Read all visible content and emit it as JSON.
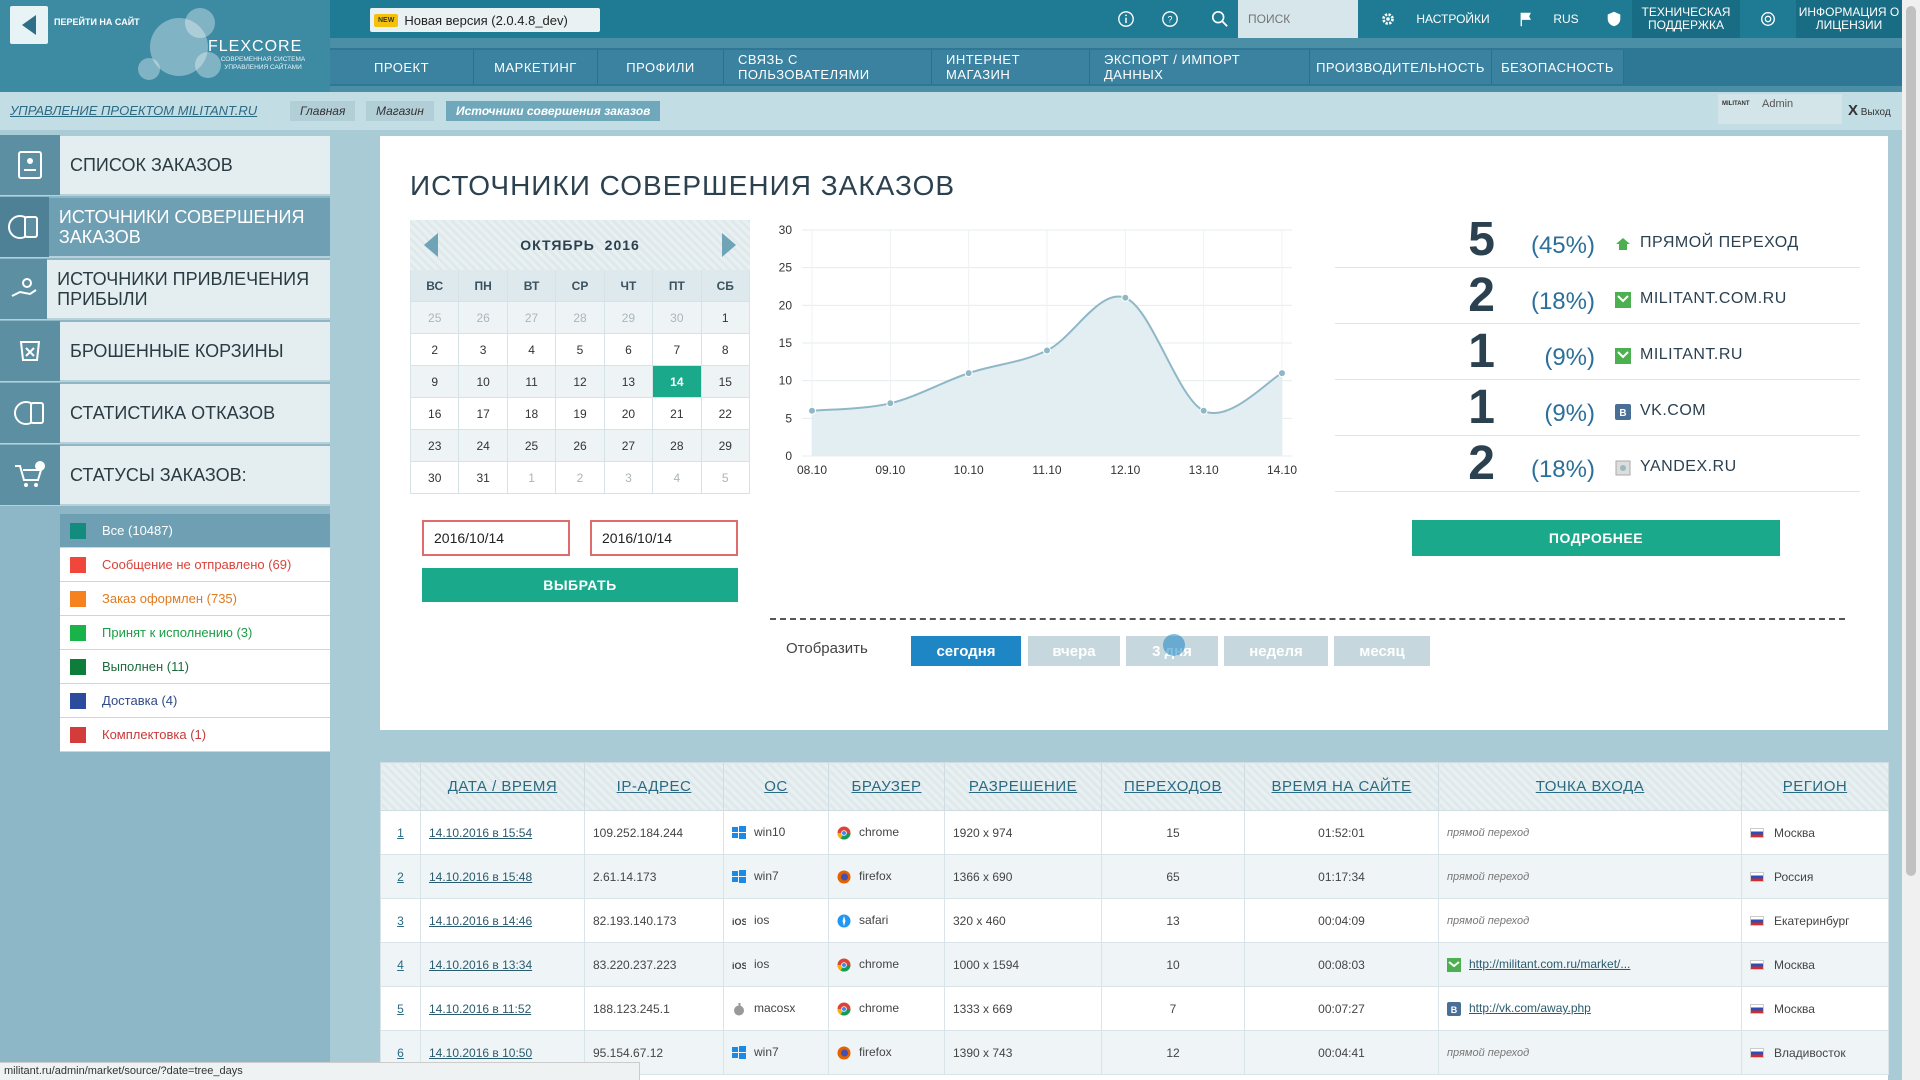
{
  "header": {
    "goto_site": "ПЕРЕЙТИ НА САЙТ",
    "logo": "FLEXCORE",
    "logo_sub": "СОВРЕМЕННАЯ СИСТЕМА УПРАВЛЕНИЯ САЙТАМИ",
    "new_badge": "NEW",
    "new_version": "Новая версия (2.0.4.8_dev)",
    "search_placeholder": "ПОИСК",
    "settings": "НАСТРОЙКИ",
    "lang": "RUS",
    "support": "ТЕХНИЧЕСКАЯ ПОДДЕРЖКА",
    "license": "ИНФОРМАЦИЯ О ЛИЦЕНЗИИ",
    "nav": [
      "ПРОЕКТ",
      "МАРКЕТИНГ",
      "ПРОФИЛИ",
      "СВЯЗЬ С ПОЛЬЗОВАТЕЛЯМИ",
      "ИНТЕРНЕТ МАГАЗИН",
      "ЭКСПОРТ / ИМПОРТ ДАННЫХ",
      "ПРОИЗВОДИТЕЛЬНОСТЬ",
      "БЕЗОПАСНОСТЬ"
    ]
  },
  "breadcrumbs": {
    "project": "УПРАВЛЕНИЕ ПРОЕКТОМ MILITANT.RU",
    "items": [
      "Главная",
      "Магазин",
      "Источники совершения заказов"
    ]
  },
  "user": {
    "name": "Admin",
    "logo": "MILITANT",
    "exit": "Выход",
    "exit_x": "X"
  },
  "sidebar": {
    "items": [
      "СПИСОК ЗАКАЗОВ",
      "ИСТОЧНИКИ СОВЕРШЕНИЯ ЗАКАЗОВ",
      "ИСТОЧНИКИ ПРИВЛЕЧЕНИЯ ПРИБЫЛИ",
      "БРОШЕННЫЕ КОРЗИНЫ",
      "СТАТИСТИКА ОТКАЗОВ",
      "СТАТУСЫ ЗАКАЗОВ:"
    ],
    "statuses": [
      {
        "label": "Все (10487)",
        "color": "#128c7e",
        "text": "#ffffff"
      },
      {
        "label": "Сообщение не отправлено (69)",
        "color": "#f0463c",
        "text": "#d9433b"
      },
      {
        "label": "Заказ оформлен (735)",
        "color": "#f5821f",
        "text": "#e07a20"
      },
      {
        "label": "Принят к исполнению (3)",
        "color": "#1ab34a",
        "text": "#1c9c47"
      },
      {
        "label": "Выполнен (11)",
        "color": "#0f7d3a",
        "text": "#1d6b3c"
      },
      {
        "label": "Доставка (4)",
        "color": "#2c4a9e",
        "text": "#2f4a8a"
      },
      {
        "label": "Комплектовка (1)",
        "color": "#d43c3c",
        "text": "#c73a3a"
      }
    ]
  },
  "main": {
    "title": "ИСТОЧНИКИ СОВЕРШЕНИЯ ЗАКАЗОВ",
    "calendar": {
      "month": "ОКТЯБРЬ",
      "year": "2016",
      "dow": [
        "ВС",
        "ПН",
        "ВТ",
        "СР",
        "ЧТ",
        "ПТ",
        "СБ"
      ],
      "weeks": [
        [
          "25",
          "26",
          "27",
          "28",
          "29",
          "30",
          "1"
        ],
        [
          "2",
          "3",
          "4",
          "5",
          "6",
          "7",
          "8"
        ],
        [
          "9",
          "10",
          "11",
          "12",
          "13",
          "14",
          "15"
        ],
        [
          "16",
          "17",
          "18",
          "19",
          "20",
          "21",
          "22"
        ],
        [
          "23",
          "24",
          "25",
          "26",
          "27",
          "28",
          "29"
        ],
        [
          "30",
          "31",
          "1",
          "2",
          "3",
          "4",
          "5"
        ]
      ],
      "selected": "14"
    },
    "date_from": "2016/10/14",
    "date_to": "2016/10/14",
    "select_btn": "ВЫБРАТЬ",
    "more_btn": "ПОДРОБНЕЕ",
    "show_label": "Отобразить",
    "periods": [
      "сегодня",
      "вчера",
      "3 дня",
      "неделя",
      "месяц"
    ],
    "active_period": "сегодня"
  },
  "chart_data": {
    "type": "area",
    "x": [
      "08.10",
      "09.10",
      "10.10",
      "11.10",
      "12.10",
      "13.10",
      "14.10"
    ],
    "values": [
      6,
      7,
      11,
      14,
      21,
      6,
      11
    ],
    "ylim": [
      0,
      30
    ],
    "yticks": [
      0,
      5,
      10,
      15,
      20,
      25,
      30
    ],
    "grid": true,
    "color": "#8fb8c6"
  },
  "sources": [
    {
      "count": "5",
      "pct": "(45%)",
      "label": "ПРЯМОЙ ПЕРЕХОД",
      "icon": "home-icon",
      "color": "#4caf50"
    },
    {
      "count": "2",
      "pct": "(18%)",
      "label": "MILITANT.COM.RU",
      "icon": "site-icon",
      "color": "#4caf50"
    },
    {
      "count": "1",
      "pct": "(9%)",
      "label": "MILITANT.RU",
      "icon": "site-icon",
      "color": "#4caf50"
    },
    {
      "count": "1",
      "pct": "(9%)",
      "label": "VK.COM",
      "icon": "vk-icon",
      "color": "#4a6f96"
    },
    {
      "count": "2",
      "pct": "(18%)",
      "label": "YANDEX.RU",
      "icon": "yandex-icon",
      "color": "#aaaaaa"
    }
  ],
  "table": {
    "headers": [
      "ДАТА / ВРЕМЯ",
      "IP-АДРЕС",
      "ОС",
      "БРАУЗЕР",
      "РАЗРЕШЕНИЕ",
      "ПЕРЕХОДОВ",
      "ВРЕМЯ НА САЙТЕ",
      "ТОЧКА ВХОДА",
      "РЕГИОН"
    ],
    "rows": [
      {
        "n": "1",
        "dt": "14.10.2016 в 15:54",
        "ip": "109.252.184.244",
        "os": "win10",
        "os_icon": "windows-icon",
        "br": "chrome",
        "br_icon": "chrome-icon",
        "res": "1920 x 974",
        "hits": "15",
        "time": "01:52:01",
        "entry": "прямой переход",
        "entry_link": false,
        "region": "Москва"
      },
      {
        "n": "2",
        "dt": "14.10.2016 в 15:48",
        "ip": "2.61.14.173",
        "os": "win7",
        "os_icon": "windows-icon",
        "br": "firefox",
        "br_icon": "firefox-icon",
        "res": "1366 x 690",
        "hits": "65",
        "time": "01:17:34",
        "entry": "прямой переход",
        "entry_link": false,
        "region": "Россия"
      },
      {
        "n": "3",
        "dt": "14.10.2016 в 14:46",
        "ip": "82.193.140.173",
        "os": "ios",
        "os_icon": "ios-icon",
        "br": "safari",
        "br_icon": "safari-icon",
        "res": "320 x 460",
        "hits": "13",
        "time": "00:04:09",
        "entry": "прямой переход",
        "entry_link": false,
        "region": "Екатеринбург"
      },
      {
        "n": "4",
        "dt": "14.10.2016 в 13:34",
        "ip": "83.220.237.223",
        "os": "ios",
        "os_icon": "ios-icon",
        "br": "chrome",
        "br_icon": "chrome-icon",
        "res": "1000 x 1594",
        "hits": "10",
        "time": "00:08:03",
        "entry": "http://militant.com.ru/market/...",
        "entry_link": true,
        "entry_icon": "site-icon",
        "region": "Москва"
      },
      {
        "n": "5",
        "dt": "14.10.2016 в 11:52",
        "ip": "188.123.245.1",
        "os": "macosx",
        "os_icon": "apple-icon",
        "br": "chrome",
        "br_icon": "chrome-icon",
        "res": "1333 x 669",
        "hits": "7",
        "time": "00:07:27",
        "entry": "http://vk.com/away.php",
        "entry_link": true,
        "entry_icon": "vk-icon",
        "region": "Москва"
      },
      {
        "n": "6",
        "dt": "14.10.2016 в 10:50",
        "ip": "95.154.67.12",
        "os": "win7",
        "os_icon": "windows-icon",
        "br": "firefox",
        "br_icon": "firefox-icon",
        "res": "1390 x 743",
        "hits": "12",
        "time": "00:04:41",
        "entry": "прямой переход",
        "entry_link": false,
        "region": "Владивосток"
      }
    ]
  },
  "statusbar": "militant.ru/admin/market/source/?date=tree_days"
}
